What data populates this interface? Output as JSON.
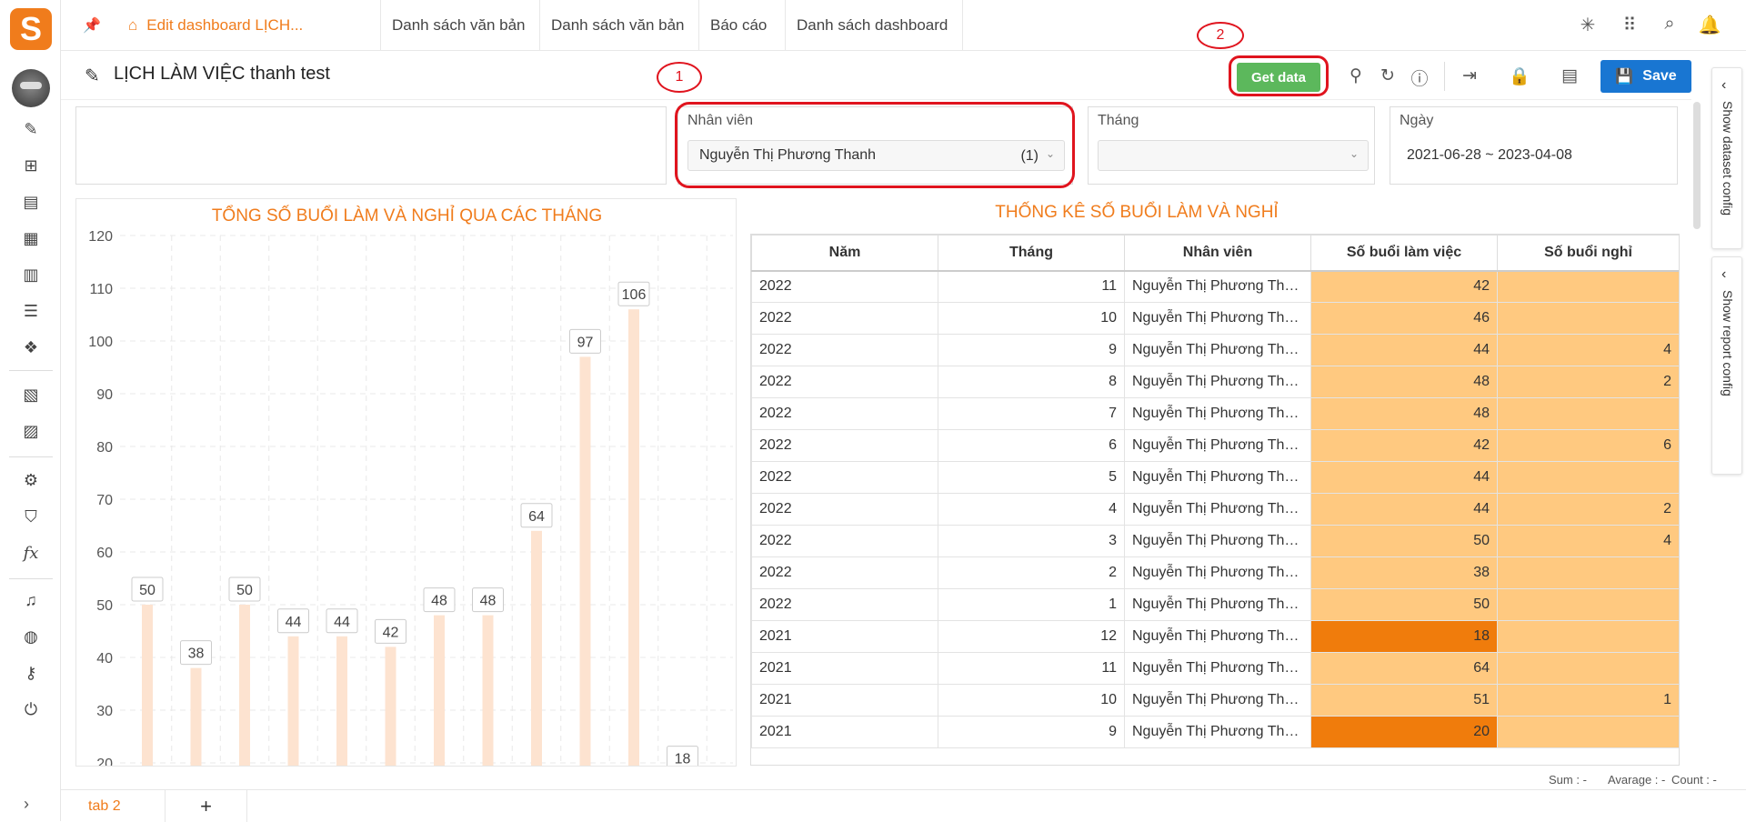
{
  "app": {
    "logo_letter": "S"
  },
  "tabs": [
    {
      "label": "Edit dashboard LỊCH..."
    },
    {
      "label": "Danh sách văn bản"
    },
    {
      "label": "Danh sách văn bản"
    },
    {
      "label": "Báo cáo"
    },
    {
      "label": "Danh sách dashboard"
    }
  ],
  "header": {
    "title": "LỊCH LÀM VIỆC thanh test",
    "get_data_label": "Get data",
    "save_label": "Save"
  },
  "annotations": {
    "one": "1",
    "two": "2"
  },
  "filters": {
    "nhan_vien_label": "Nhân viên",
    "nhan_vien_value": "Nguyễn Thị Phương Thanh",
    "nhan_vien_count": "(1)",
    "thang_label": "Tháng",
    "ngay_label": "Ngày",
    "ngay_value": "2021-06-28 ~ 2023-04-08"
  },
  "right_panel": {
    "dataset": "Show dataset config",
    "report": "Show report config"
  },
  "chart_data": {
    "type": "bar",
    "title": "TỔNG SỐ BUỔI LÀM VÀ NGHỈ QUA CÁC THÁNG",
    "values": [
      50,
      38,
      50,
      44,
      44,
      42,
      48,
      48,
      64,
      97,
      106,
      18
    ],
    "y_ticks": [
      20,
      30,
      40,
      50,
      60,
      70,
      80,
      90,
      100,
      110,
      120
    ],
    "ylim": [
      20,
      120
    ],
    "grid": true,
    "bar_color": "#fde3d0"
  },
  "table": {
    "title": "THỐNG KÊ SỐ BUỔI LÀM VÀ NGHỈ",
    "columns": [
      "Năm",
      "Tháng",
      "Nhân viên",
      "Số buổi làm việc",
      "Số buổi nghỉ"
    ],
    "rows": [
      [
        "2022",
        "11",
        "Nguyễn Thị Phương Tha...",
        "42",
        ""
      ],
      [
        "2022",
        "10",
        "Nguyễn Thị Phương Tha...",
        "46",
        ""
      ],
      [
        "2022",
        "9",
        "Nguyễn Thị Phương Tha...",
        "44",
        "4"
      ],
      [
        "2022",
        "8",
        "Nguyễn Thị Phương Tha...",
        "48",
        "2"
      ],
      [
        "2022",
        "7",
        "Nguyễn Thị Phương Tha...",
        "48",
        ""
      ],
      [
        "2022",
        "6",
        "Nguyễn Thị Phương Tha...",
        "42",
        "6"
      ],
      [
        "2022",
        "5",
        "Nguyễn Thị Phương Tha...",
        "44",
        ""
      ],
      [
        "2022",
        "4",
        "Nguyễn Thị Phương Tha...",
        "44",
        "2"
      ],
      [
        "2022",
        "3",
        "Nguyễn Thị Phương Tha...",
        "50",
        "4"
      ],
      [
        "2022",
        "2",
        "Nguyễn Thị Phương Tha...",
        "38",
        ""
      ],
      [
        "2022",
        "1",
        "Nguyễn Thị Phương Tha...",
        "50",
        ""
      ],
      [
        "2021",
        "12",
        "Nguyễn Thị Phương Tha...",
        "18",
        ""
      ],
      [
        "2021",
        "11",
        "Nguyễn Thị Phương Tha...",
        "64",
        ""
      ],
      [
        "2021",
        "10",
        "Nguyễn Thị Phương Tha...",
        "51",
        "1"
      ],
      [
        "2021",
        "9",
        "Nguyễn Thị Phương Tha...",
        "20",
        ""
      ]
    ],
    "dark_rows": [
      11,
      14
    ]
  },
  "footer": {
    "sum": "Sum : -",
    "avg": "Avarage : -",
    "count": "Count : -"
  },
  "bottom_tabs": {
    "tab": "tab 2",
    "add": "+"
  },
  "colors": {
    "accent": "#f07c1c",
    "save_blue": "#1976d2",
    "get_data_green": "#5cb85c",
    "annotation_red": "#e0141e",
    "cell_highlight": "#ffc980",
    "cell_dark": "#f07c0c"
  }
}
